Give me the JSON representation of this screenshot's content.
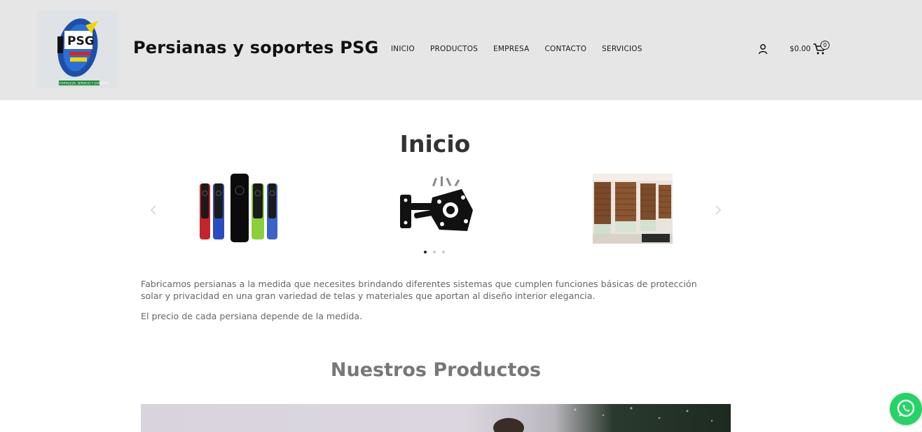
{
  "header": {
    "site_title": "Persianas y soportes PSG",
    "logo_text": "PSG",
    "logo_tagline": "FORTALEZA, SERVICIO Y GARANTIA",
    "nav": [
      {
        "label": "INICIO"
      },
      {
        "label": "PRODUCTOS"
      },
      {
        "label": "EMPRESA"
      },
      {
        "label": "CONTACTO"
      },
      {
        "label": "SERVICIOS"
      }
    ],
    "user_icon": "user-icon",
    "cart": {
      "total": "$0.00",
      "count": "0",
      "icon": "cart-icon"
    }
  },
  "main": {
    "title": "Inicio",
    "carousel": {
      "slides": [
        {
          "alt": "Controles remotos de colores",
          "icon": "remote-controls-image"
        },
        {
          "alt": "Soporte articulado para TV",
          "icon": "tv-mount-image"
        },
        {
          "alt": "Persianas de madera",
          "icon": "blinds-image"
        }
      ],
      "active_index": 0,
      "dot_count": 3
    },
    "description": "Fabricamos persianas a la medida que necesites brindando diferentes sistemas que cumplen funciones básicas de protección solar y privacidad en una gran variedad de telas y materiales que aportan al diseño interior elegancia.",
    "price_note": "El precio de cada persiana depende de la medida.",
    "products_title": "Nuestros Productos"
  },
  "colors": {
    "header_bg": "#e6e6e6",
    "whatsapp": "#25d366",
    "text_muted": "#666666"
  }
}
